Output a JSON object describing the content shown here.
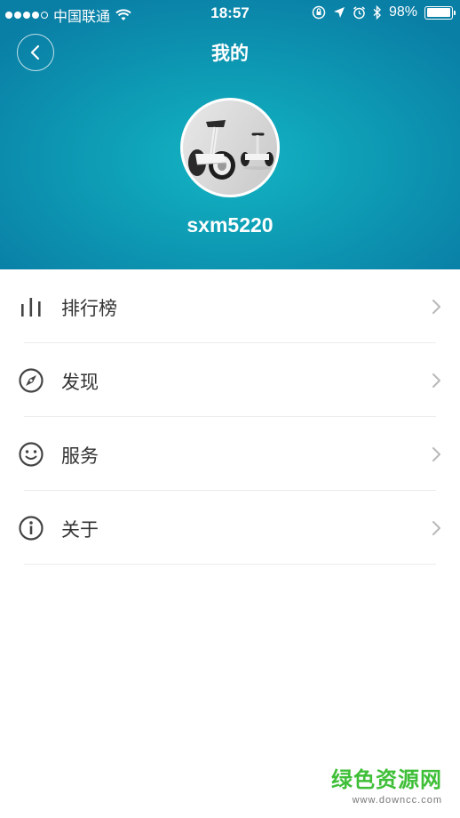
{
  "status_bar": {
    "carrier": "中国联通",
    "time": "18:57",
    "battery": "98%",
    "battery_level": 0.98,
    "signal_bars_filled": 4,
    "signal_bars_total": 5
  },
  "nav": {
    "title": "我的",
    "back_icon": "chevron-left-icon"
  },
  "profile": {
    "username": "sxm5220",
    "avatar_icon": "self-balancing-scooter-avatar"
  },
  "menu": {
    "items": [
      {
        "label": "排行榜",
        "icon": "bar-chart-icon"
      },
      {
        "label": "发现",
        "icon": "compass-icon"
      },
      {
        "label": "服务",
        "icon": "smiley-icon"
      },
      {
        "label": "关于",
        "icon": "info-icon"
      }
    ]
  },
  "watermark": {
    "main": "绿色资源网",
    "sub": "www.downcc.com"
  },
  "colors": {
    "header_primary": "#0e9fb6",
    "header_dark": "#0a7fa6",
    "text_primary": "#333333",
    "divider": "#ececec",
    "chevron": "#b8b8b8",
    "watermark_green": "#3fbf38"
  }
}
